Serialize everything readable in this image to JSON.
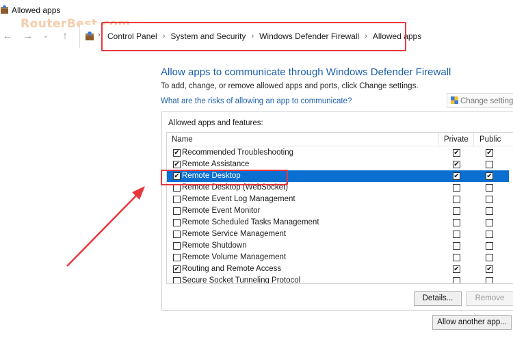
{
  "window": {
    "title": "Allowed apps"
  },
  "watermark": "RouterBest.com",
  "breadcrumbs": [
    "Control Panel",
    "System and Security",
    "Windows Defender Firewall",
    "Allowed apps"
  ],
  "heading": "Allow apps to communicate through Windows Defender Firewall",
  "subtext": "To add, change, or remove allowed apps and ports, click Change settings.",
  "risk_link": "What are the risks of allowing an app to communicate?",
  "change_settings_label": "Change settings",
  "panel_label": "Allowed apps and features:",
  "columns": {
    "name": "Name",
    "private": "Private",
    "public": "Public"
  },
  "rows": [
    {
      "name": "Recommended Troubleshooting",
      "enabled": true,
      "private": true,
      "public": true
    },
    {
      "name": "Remote Assistance",
      "enabled": true,
      "private": true,
      "public": false
    },
    {
      "name": "Remote Desktop",
      "enabled": true,
      "private": true,
      "public": true
    },
    {
      "name": "Remote Desktop (WebSocket)",
      "enabled": false,
      "private": false,
      "public": false
    },
    {
      "name": "Remote Event Log Management",
      "enabled": false,
      "private": false,
      "public": false
    },
    {
      "name": "Remote Event Monitor",
      "enabled": false,
      "private": false,
      "public": false
    },
    {
      "name": "Remote Scheduled Tasks Management",
      "enabled": false,
      "private": false,
      "public": false
    },
    {
      "name": "Remote Service Management",
      "enabled": false,
      "private": false,
      "public": false
    },
    {
      "name": "Remote Shutdown",
      "enabled": false,
      "private": false,
      "public": false
    },
    {
      "name": "Remote Volume Management",
      "enabled": false,
      "private": false,
      "public": false
    },
    {
      "name": "Routing and Remote Access",
      "enabled": true,
      "private": true,
      "public": true
    },
    {
      "name": "Secure Socket Tunneling Protocol",
      "enabled": false,
      "private": false,
      "public": false
    }
  ],
  "selected_row": "Remote Desktop",
  "buttons": {
    "details": "Details...",
    "remove": "Remove",
    "allow_another": "Allow another app..."
  },
  "colors": {
    "accent": "#0a6fd1",
    "link": "#1b5fa8",
    "highlight": "#e8383d"
  }
}
